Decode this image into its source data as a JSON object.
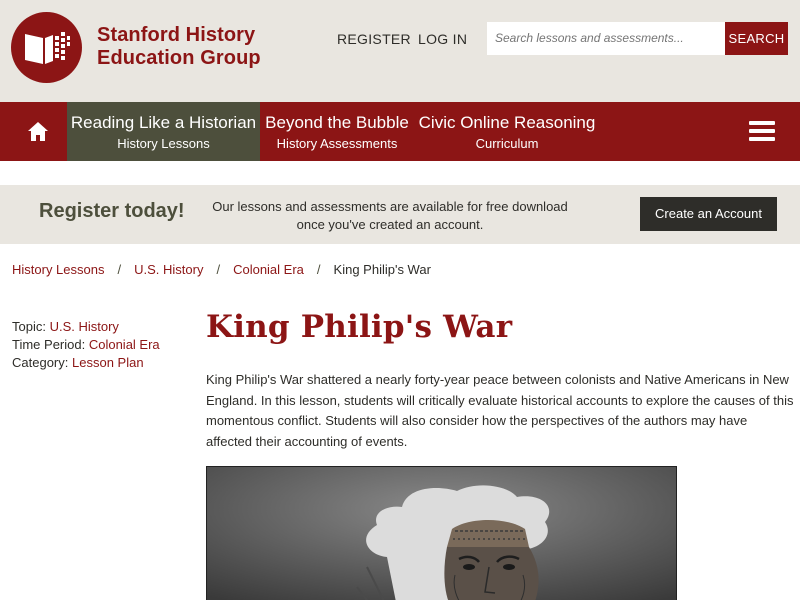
{
  "header": {
    "logo_line1": "Stanford History",
    "logo_line2": "Education Group",
    "register_link": "REGISTER",
    "login_link": "LOG IN",
    "search_placeholder": "Search lessons and assessments...",
    "search_button": "SEARCH"
  },
  "nav": {
    "home_icon": "home-icon",
    "items": [
      {
        "label": "Reading Like a Historian",
        "sub": "History Lessons",
        "active": true
      },
      {
        "label": "Beyond the Bubble",
        "sub": "History Assessments",
        "active": false
      },
      {
        "label": "Civic Online Reasoning",
        "sub": "Curriculum",
        "active": false
      }
    ],
    "menu_icon": "hamburger-menu-icon"
  },
  "register_band": {
    "title": "Register today!",
    "text_line1": "Our lessons and assessments are available for free download",
    "text_line2": "once you've created an account.",
    "button": "Create an Account"
  },
  "breadcrumb": {
    "items": [
      "History Lessons",
      "U.S. History",
      "Colonial Era",
      "King Philip's War"
    ],
    "separator": "/"
  },
  "meta": {
    "topic_label": "Topic:",
    "topic_value": "U.S. History",
    "period_label": "Time Period:",
    "period_value": "Colonial Era",
    "category_label": "Category:",
    "category_value": "Lesson Plan"
  },
  "main": {
    "title": "King Philip's War",
    "intro": "King Philip's War shattered a nearly forty-year peace between colonists and Native Americans in New England. In this lesson, students will critically evaluate historical accounts to explore the causes of this momentous conflict. Students will also consider how the perspectives of the authors may have affected their accounting of events."
  },
  "colors": {
    "brand": "#8c1515",
    "header_bg": "#e9e6e0",
    "active_nav": "#4d4f3c",
    "dark_button": "#2e2d29"
  }
}
